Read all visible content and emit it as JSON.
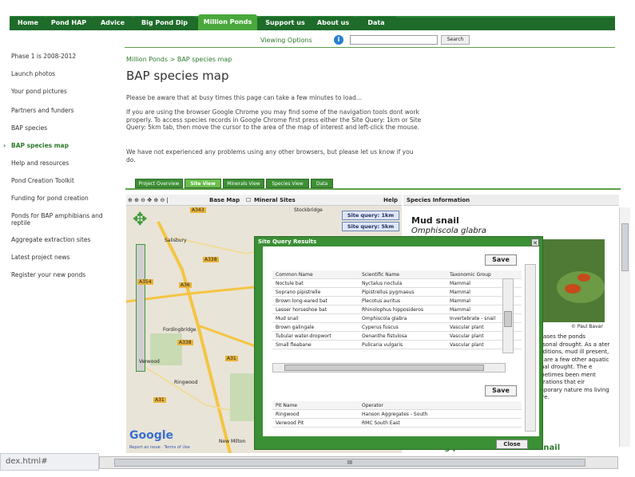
{
  "nav": {
    "tabs": [
      "Home",
      "Pond HAP",
      "Advice",
      "Big Pond Dip",
      "Million Ponds",
      "Support us",
      "About us",
      "Data"
    ],
    "active": "Million Ponds"
  },
  "viewbar": {
    "label": "Viewing Options",
    "search_button": "Search"
  },
  "sidebar": {
    "items": [
      "Phase 1 is 2008-2012",
      "Launch photos",
      "Your pond pictures",
      "Partners and funders",
      "BAP species",
      "BAP species map",
      "Help and resources",
      "Pond Creation Toolkit",
      "Funding for pond creation",
      "Ponds for BAP amphibians and reptile",
      "Aggregate extraction sites",
      "Latest project news",
      "Register your new ponds"
    ],
    "active": "BAP species map"
  },
  "breadcrumb": "Million Ponds > BAP species map",
  "page_title": "BAP species map",
  "paragraphs": [
    "Please be aware that at busy times this page can take a few minutes to load...",
    "If you are using the browser Google Chrome you may find some of the navigation tools dont work properly. To access species records in Google Chrome first press either the Site Query: 1km or Site Query: 5km tab, then move the cursor to the area of the map of interest and left-click the mouse.",
    "We have not experienced any problems using any other browsers, but please let us know if you do."
  ],
  "project_tabs": [
    "Project Overview",
    "Site View",
    "Minerals View",
    "Species View",
    "Data"
  ],
  "active_project_tab": "Site View",
  "map_toolbar": {
    "base_map": "Base Map",
    "mineral_sites": "Mineral Sites",
    "help": "Help"
  },
  "map": {
    "site_query_1km": "Site query: 1km",
    "site_query_5km": "Site query: 5km",
    "places": [
      "Stockbridge",
      "Salisbury",
      "Fordingbridge",
      "Ringwood",
      "Verwood",
      "New Milton"
    ],
    "roads": [
      "A343",
      "A338",
      "A36",
      "A354",
      "A31",
      "A338",
      "A31"
    ],
    "logo": "Google",
    "map_footer": "Report an issue · Terms of Use"
  },
  "species_panel": {
    "header": "Species Information",
    "common_name": "Mud snail",
    "scientific_name": "Omphiscola glabra",
    "credit": "© Paul Bavar",
    "description": "y) cases the ponds seasonal drought. As a ater conditions, mud ill present, but are a few other aquatic sional drought. The e sometimes been ment operations that eir temporary nature ms living there.",
    "bottom_heading": "Creating ponds for the mud snail"
  },
  "dialog": {
    "title": "Site Query Results",
    "save": "Save",
    "save2": "Save",
    "close": "Close",
    "columns": [
      "Common Name",
      "Scientific Name",
      "Taxonomic Group"
    ],
    "rows": [
      [
        "Noctule bat",
        "Nyctalus noctula",
        "Mammal"
      ],
      [
        "Soprano pipistrelle",
        "Pipistrellus pygmaeus",
        "Mammal"
      ],
      [
        "Brown long-eared bat",
        "Plecotus auritus",
        "Mammal"
      ],
      [
        "Lesser horseshoe bat",
        "Rhinolophus hipposideros",
        "Mammal"
      ],
      [
        "Mud snail",
        "Omphiscola glabra",
        "Invertebrate - snail"
      ],
      [
        "Brown galingale",
        "Cyperus fuscus",
        "Vascular plant"
      ],
      [
        "Tubular water-dropwort",
        "Oenanthe fistulosa",
        "Vascular plant"
      ],
      [
        "Small fleabane",
        "Pulicaria vulgaris",
        "Vascular plant"
      ]
    ],
    "columns2": [
      "Pit Name",
      "Operator"
    ],
    "rows2": [
      [
        "Ringwood",
        "Hanson Aggregates - South"
      ],
      [
        "Verwood Pit",
        "RMC South East"
      ]
    ]
  },
  "status_text": "dex.html#"
}
